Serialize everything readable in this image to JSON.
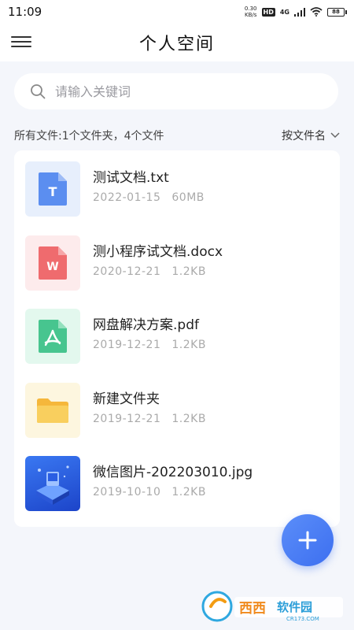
{
  "status_bar": {
    "time": "11:09",
    "speed_value": "0.30",
    "speed_unit": "KB/s",
    "hd_badge": "HD",
    "network": "4G",
    "battery": "88"
  },
  "header": {
    "title": "个人空间"
  },
  "search": {
    "placeholder": "请输入关键词"
  },
  "summary": {
    "text": "所有文件:1个文件夹，4个文件",
    "sort_label": "按文件名"
  },
  "files": [
    {
      "name": "测试文档.txt",
      "date": "2022-01-15",
      "size": "60MB",
      "type": "txt",
      "badge": "T",
      "bg": "#e7effc",
      "color": "#5b8ef0"
    },
    {
      "name": "测小程序试文档.docx",
      "date": "2020-12-21",
      "size": "1.2KB",
      "type": "docx",
      "badge": "W",
      "bg": "#fdebec",
      "color": "#ef6b6e"
    },
    {
      "name": "网盘解决方案.pdf",
      "date": "2019-12-21",
      "size": "1.2KB",
      "type": "pdf",
      "bg": "#e3f8ee",
      "color": "#47c58f"
    },
    {
      "name": "新建文件夹",
      "date": "2019-12-21",
      "size": "1.2KB",
      "type": "folder",
      "bg": "#fdf6df",
      "color": "#f7c646"
    },
    {
      "name": "微信图片-202203010.jpg",
      "date": "2019-10-10",
      "size": "1.2KB",
      "type": "image",
      "bg": "#2d62e8",
      "color": "#1a3fb5"
    }
  ],
  "fab": {
    "icon": "plus-icon",
    "color": "#4a7cf4"
  },
  "watermark": {
    "text": "西西软件园",
    "domain": "CR173.COM"
  }
}
